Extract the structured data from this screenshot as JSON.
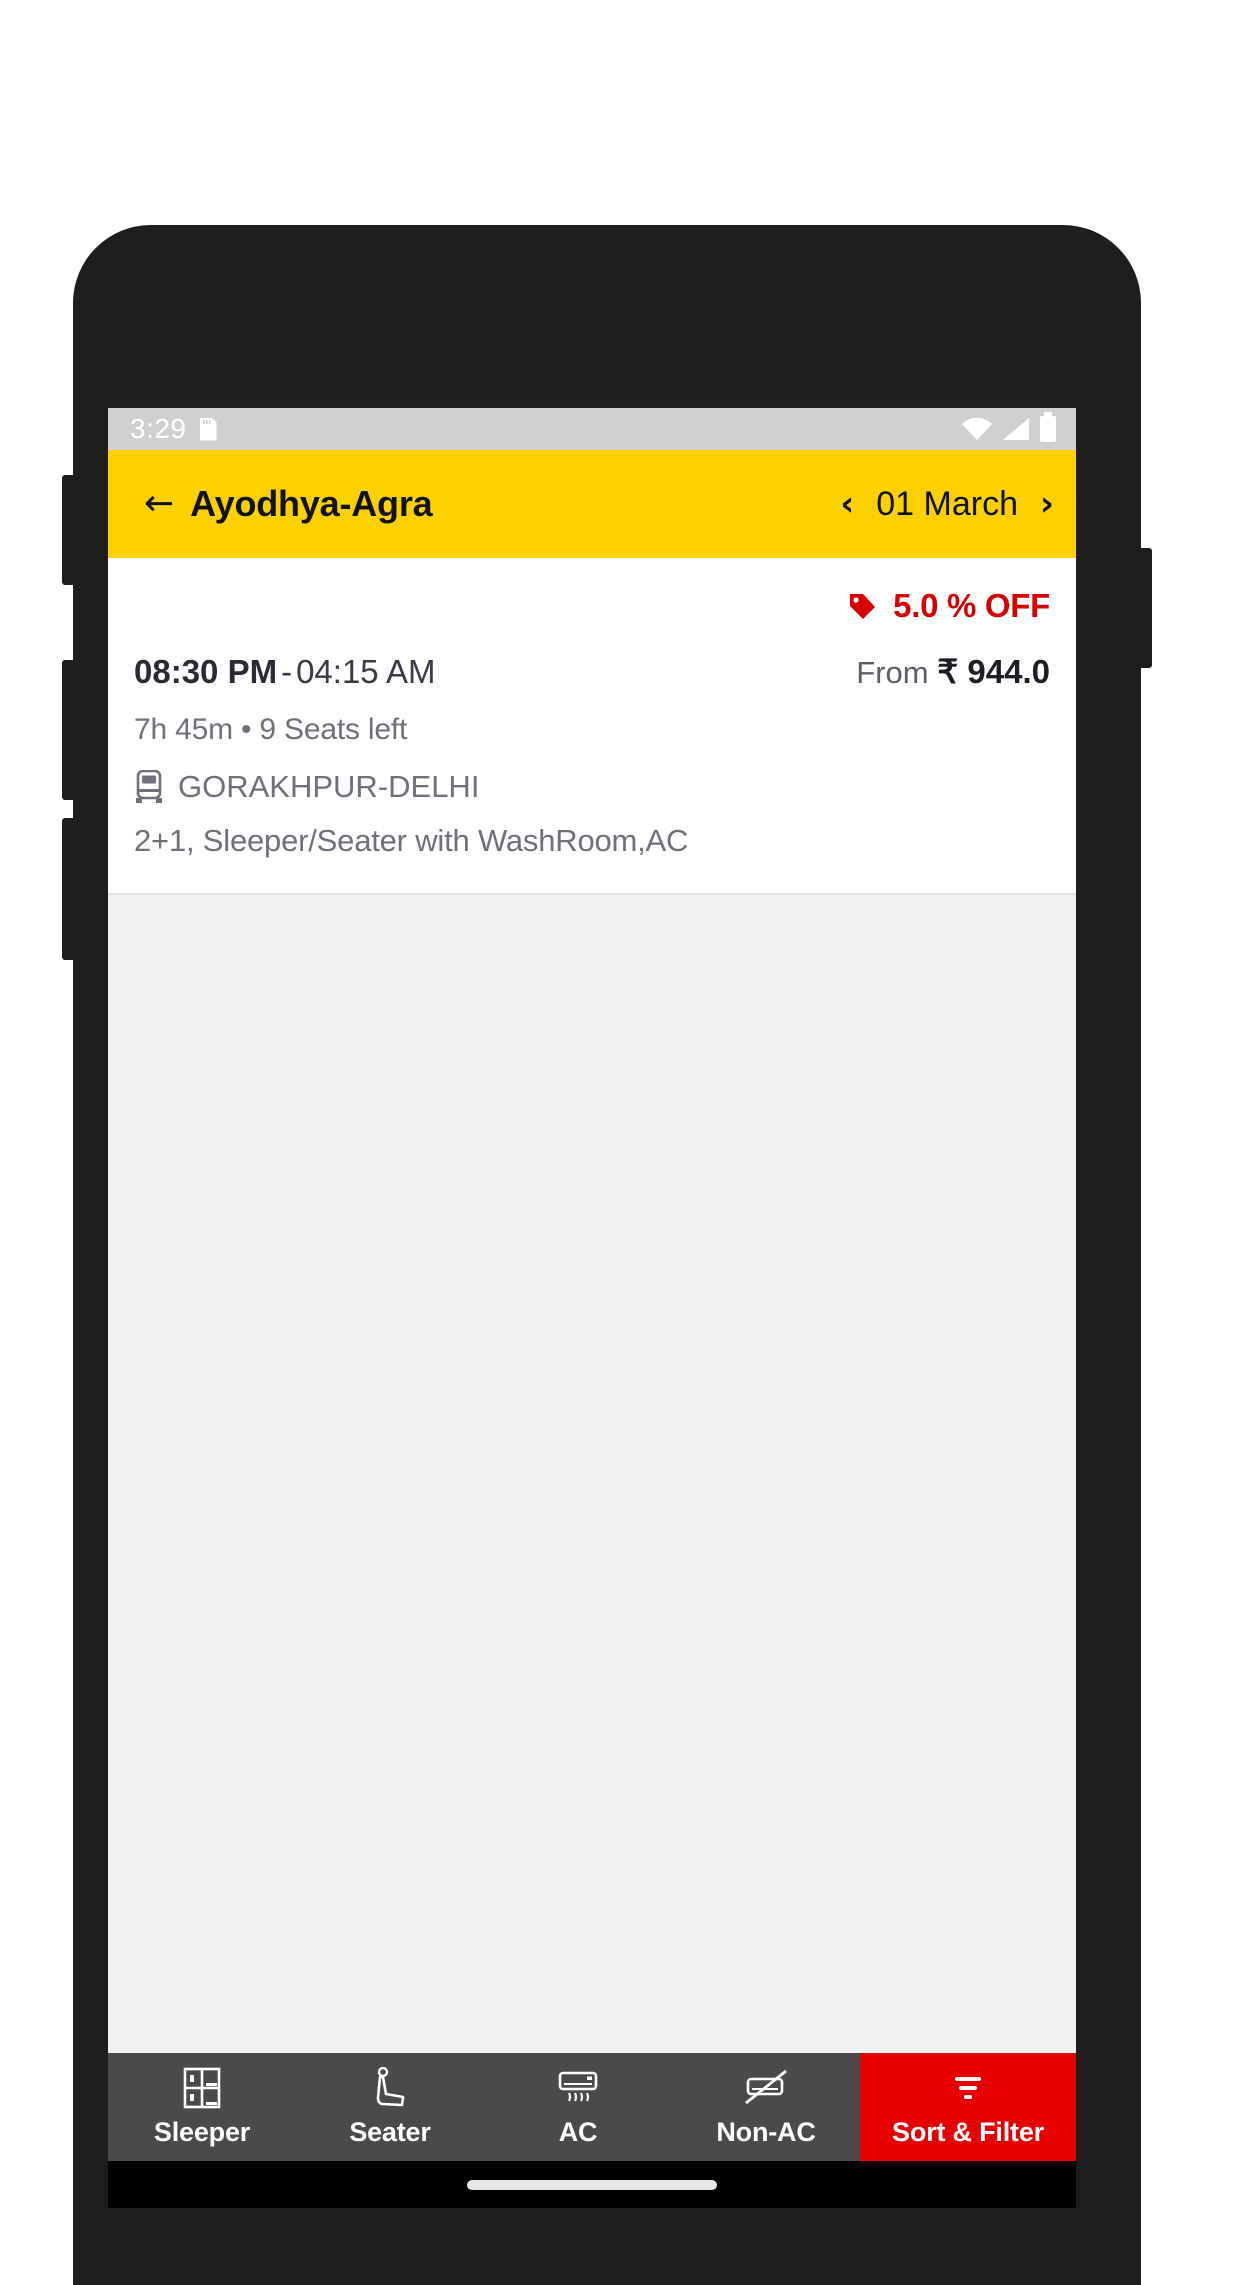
{
  "status_bar": {
    "time": "3:29",
    "icons": [
      "sd-card-icon",
      "wifi-icon",
      "signal-icon",
      "battery-icon"
    ]
  },
  "app_bar": {
    "back_icon": "←",
    "title": "Ayodhya-Agra",
    "date": "01 March",
    "prev_icon": "‹",
    "next_icon": "›",
    "background_color": "#fdd100"
  },
  "bus_card": {
    "offer": "5.0 % OFF",
    "offer_color": "#d50000",
    "offer_icon": "tag-icon",
    "departure_time": "08:30 PM",
    "separator": "-",
    "arrival_time": "04:15 AM",
    "price_prefix": "From",
    "price": "₹ 944.0",
    "duration": "7h 45m",
    "dot": "•",
    "seats_left": "9 Seats left",
    "meta_line": "7h 45m  •  9 Seats left",
    "operator": "GORAKHPUR-DELHI",
    "operator_icon": "bus-icon",
    "bus_type": "2+1, Sleeper/Seater with WashRoom,AC"
  },
  "bottom_nav": {
    "items": [
      {
        "label": "Sleeper",
        "icon": "sleeper-berth-icon"
      },
      {
        "label": "Seater",
        "icon": "seat-icon"
      },
      {
        "label": "AC",
        "icon": "air-conditioner-icon"
      },
      {
        "label": "Non-AC",
        "icon": "air-conditioner-crossed-icon"
      },
      {
        "label": "Sort & Filter",
        "icon": "filter-icon"
      }
    ],
    "background_color": "#4a4a4a",
    "accent_color": "#e60000"
  }
}
